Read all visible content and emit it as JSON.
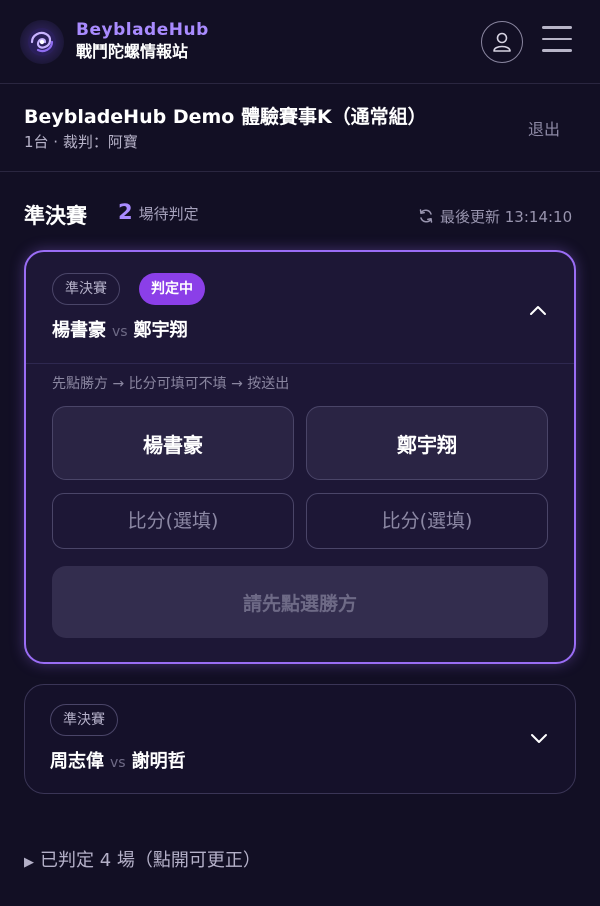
{
  "header": {
    "brand_name": "BeybladeHub",
    "brand_sub": "戰鬥陀螺情報站",
    "logo_icon": "beyblade-swirl-icon",
    "user_icon": "user-icon",
    "menu_icon": "hamburger-menu-icon"
  },
  "event": {
    "title": "BeybladeHub Demo 體驗賽事K（通常組）",
    "subtitle": "1台 · 裁判：阿寶",
    "logout_label": "退出"
  },
  "section": {
    "title": "準決賽",
    "pending_count": "2",
    "pending_label": "場待判定",
    "updated_label": "最後更新 13:14:10",
    "refresh_icon": "refresh-icon"
  },
  "active_match": {
    "round_tag": "準決賽",
    "status_tag": "判定中",
    "player_a": "楊書豪",
    "vs": "vs",
    "player_b": "鄭宇翔",
    "hint": "先點勝方 → 比分可填可不填 → 按送出",
    "pick_a_label": "楊書豪",
    "pick_b_label": "鄭宇翔",
    "score_a_placeholder": "比分(選填)",
    "score_b_placeholder": "比分(選填)",
    "submit_label": "請先點選勝方",
    "chevron_icon": "chevron-up-icon"
  },
  "next_match": {
    "round_tag": "準決賽",
    "player_a": "周志偉",
    "vs": "vs",
    "player_b": "謝明哲",
    "chevron_icon": "chevron-down-icon"
  },
  "judged": {
    "label": "已判定 4 場（點開可更正）"
  },
  "colors": {
    "background": "#120f24",
    "accent": "#a98bff",
    "active_border": "#9a6df5",
    "status_badge": "#8b3fe8"
  }
}
